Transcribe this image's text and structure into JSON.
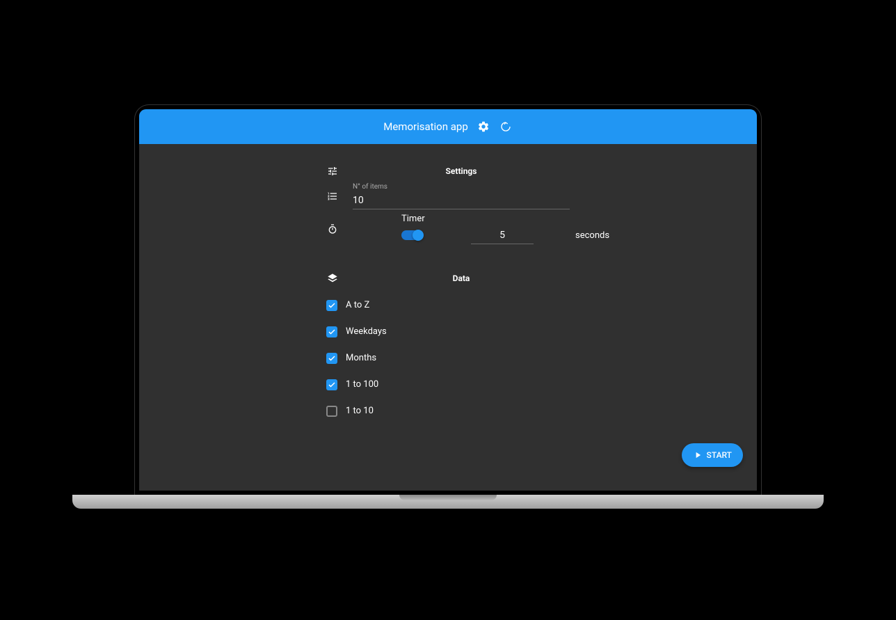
{
  "header": {
    "title": "Memorisation app"
  },
  "settings": {
    "title": "Settings",
    "items_label": "N° of items",
    "items_value": "10",
    "timer_label": "Timer",
    "timer_value": "5",
    "timer_unit": "seconds",
    "timer_enabled": true
  },
  "data": {
    "title": "Data",
    "options": [
      {
        "label": "A to Z",
        "checked": true
      },
      {
        "label": "Weekdays",
        "checked": true
      },
      {
        "label": "Months",
        "checked": true
      },
      {
        "label": "1 to 100",
        "checked": true
      },
      {
        "label": "1 to 10",
        "checked": false
      }
    ]
  },
  "fab": {
    "label": "START"
  }
}
